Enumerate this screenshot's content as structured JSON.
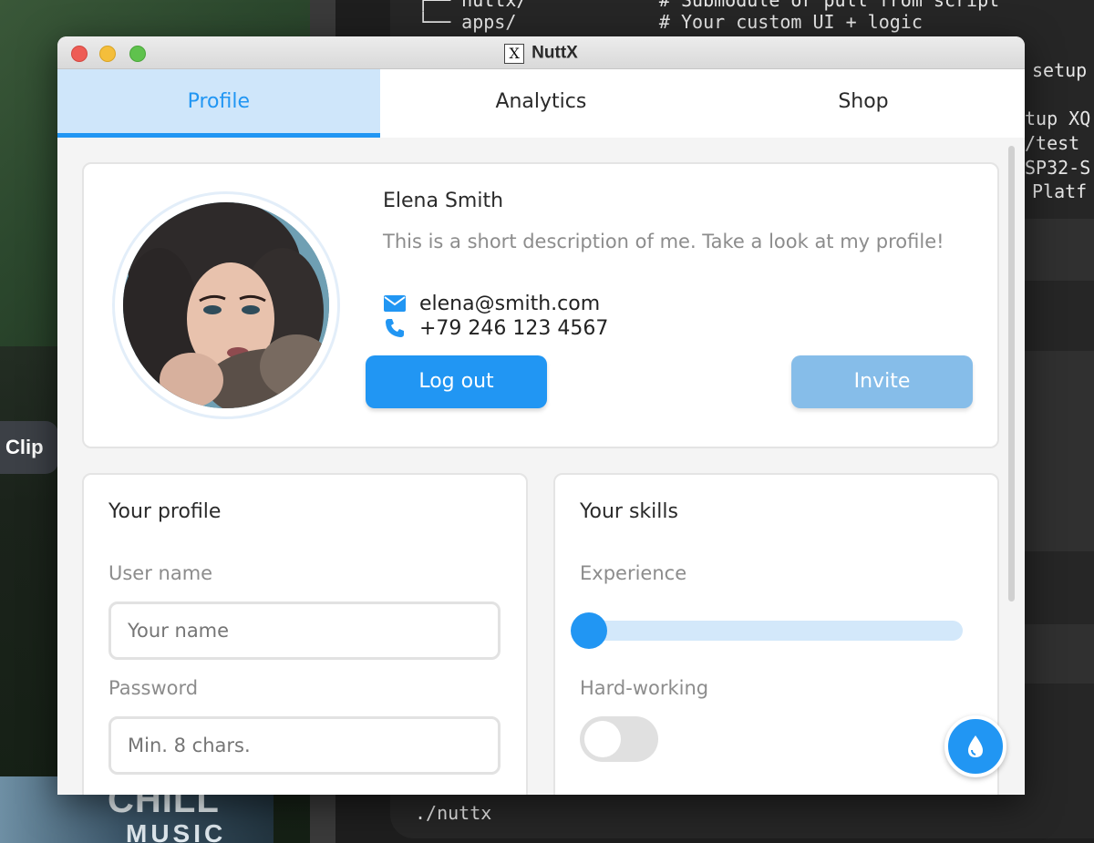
{
  "background": {
    "clip_label": "Clip",
    "album": {
      "title": "CHILL",
      "subtitle": "MUSIC"
    },
    "terminal_lines": [
      "├── nuttx/            # Submodule or pull from script",
      "└── apps/             # Your custom UI + logic",
      "setup",
      "tup XQ",
      "/test",
      "SP32-S",
      "Platf",
      "./nuttx"
    ]
  },
  "window": {
    "title": "NuttX",
    "title_icon": "X",
    "colors": {
      "accent": "#2196f3",
      "accent_light": "#cfe6fa",
      "invite": "#86bde9"
    }
  },
  "tabs": [
    {
      "label": "Profile",
      "active": true
    },
    {
      "label": "Analytics",
      "active": false
    },
    {
      "label": "Shop",
      "active": false
    }
  ],
  "profile_card": {
    "name": "Elena Smith",
    "description": "This is a short description of me. Take a look at my profile!",
    "email": "elena@smith.com",
    "phone": "+79 246 123 4567",
    "email_icon": "envelope-icon",
    "phone_icon": "phone-icon",
    "logout_label": "Log out",
    "invite_label": "Invite"
  },
  "your_profile": {
    "title": "Your profile",
    "username_label": "User name",
    "username_placeholder": "Your name",
    "password_label": "Password",
    "password_placeholder": "Min. 8 chars."
  },
  "your_skills": {
    "title": "Your skills",
    "experience_label": "Experience",
    "experience_value": 0,
    "hardworking_label": "Hard-working",
    "hardworking_on": false
  },
  "fab_icon": "water-drop-icon"
}
